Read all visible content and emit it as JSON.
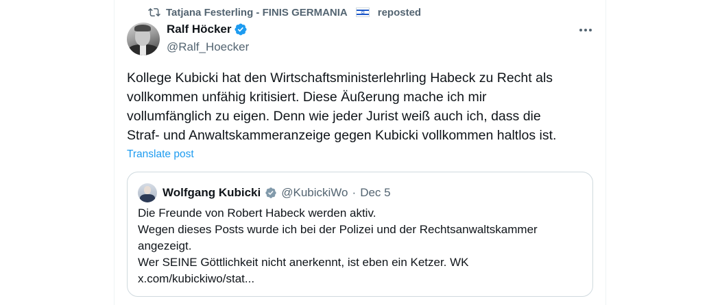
{
  "repost": {
    "user": "Tatjana Festerling - FINIS GERMANIA",
    "flag_icon": "israel-flag-icon",
    "label": "reposted"
  },
  "author": {
    "name": "Ralf Höcker",
    "handle": "@Ralf_Hoecker",
    "verified_color": "#1d9bf0"
  },
  "post": {
    "lines": [
      "Kollege Kubicki hat den Wirtschaftsministerlehrling Habeck zu Recht als",
      "vollkommen unfähig kritisiert. Diese Äußerung mache ich mir",
      "vollumfänglich zu eigen. Denn wie jeder Jurist weiß auch ich, dass die",
      "Straf- und Anwaltskammeranzeige gegen Kubicki vollkommen haltlos ist."
    ],
    "translate_label": "Translate post"
  },
  "quote": {
    "name": "Wolfgang Kubicki",
    "handle": "@KubickiWo",
    "separator": "·",
    "date": "Dec 5",
    "lines": [
      "Die Freunde von Robert Habeck werden aktiv.",
      "Wegen dieses Posts wurde ich bei der Polizei und der Rechtsanwaltskammer",
      "angezeigt.",
      "Wer SEINE Göttlichkeit nicht anerkennt, ist eben ein Ketzer. WK",
      "x.com/kubickiwo/stat..."
    ]
  },
  "colors": {
    "accent": "#1d9bf0",
    "secondary_text": "#536471",
    "border": "#cfd9de"
  }
}
